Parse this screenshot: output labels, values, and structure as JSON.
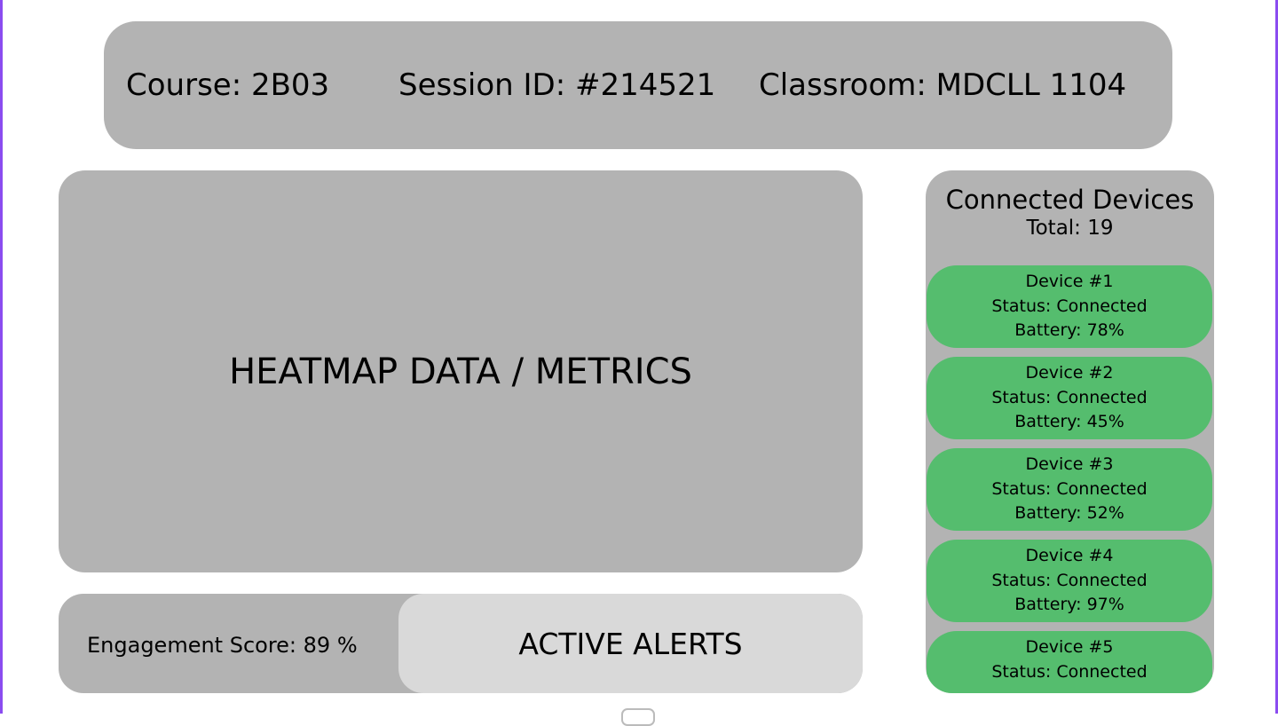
{
  "header": {
    "course": "Course: 2B03",
    "session": "Session ID: #214521",
    "classroom": "Classroom: MDCLL 1104"
  },
  "heatmap": {
    "label": "HEATMAP DATA / METRICS"
  },
  "engagement": {
    "label": "Engagement Score: 89 %",
    "score_percent": 89
  },
  "alerts": {
    "label": "ACTIVE ALERTS"
  },
  "devices": {
    "title": "Connected Devices",
    "total": "Total: 19",
    "items": [
      {
        "name": "Device #1",
        "status": "Status: Connected",
        "battery": "Battery: 78%"
      },
      {
        "name": "Device #2",
        "status": "Status: Connected",
        "battery": "Battery: 45%"
      },
      {
        "name": "Device #3",
        "status": "Status: Connected",
        "battery": "Battery: 52%"
      },
      {
        "name": "Device #4",
        "status": "Status: Connected",
        "battery": "Battery: 97%"
      },
      {
        "name": "Device #5",
        "status": "Status: Connected"
      }
    ]
  },
  "colors": {
    "panel": "#b3b3b3",
    "alerts": "#d9d9d9",
    "device_ok": "#55bd6e",
    "frame": "#8b4cf0"
  }
}
